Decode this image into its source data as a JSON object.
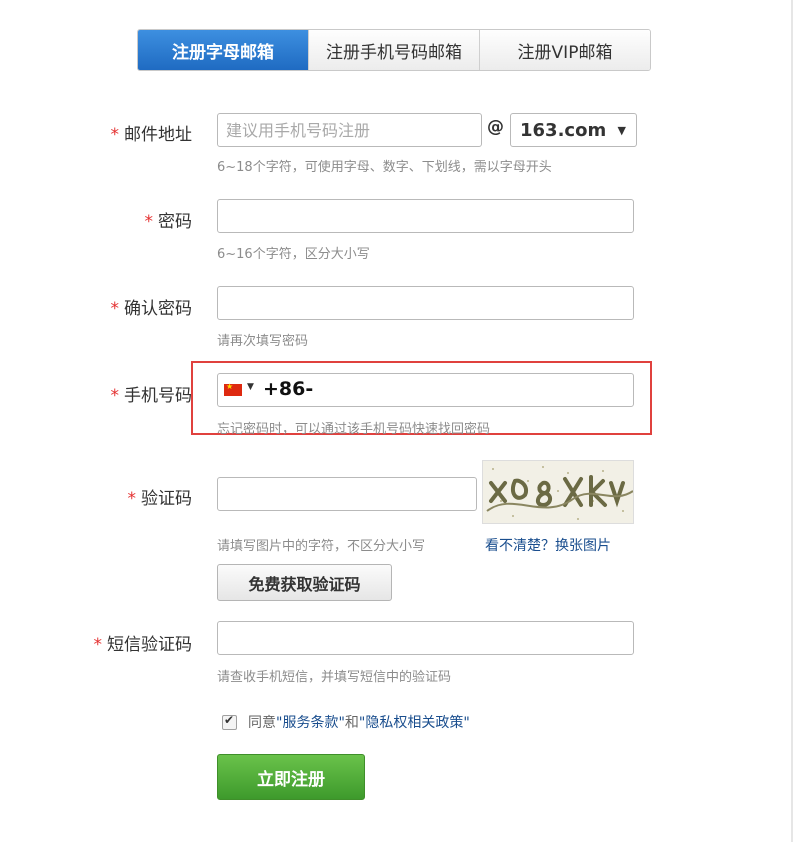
{
  "tabs": [
    {
      "label": "注册字母邮箱",
      "active": true
    },
    {
      "label": "注册手机号码邮箱",
      "active": false
    },
    {
      "label": "注册VIP邮箱",
      "active": false
    }
  ],
  "required_mark": "*",
  "email": {
    "label": "邮件地址",
    "placeholder": "建议用手机号码注册",
    "value": "",
    "at": "@",
    "domain_selected": "163.com",
    "hint": "6~18个字符，可使用字母、数字、下划线，需以字母开头"
  },
  "password": {
    "label": "密码",
    "value": "",
    "hint": "6~16个字符，区分大小写"
  },
  "confirm_password": {
    "label": "确认密码",
    "value": "",
    "hint": "请再次填写密码"
  },
  "phone": {
    "label": "手机号码",
    "country_flag": "china-flag-icon",
    "prefix": "+86-",
    "value": "",
    "hint": "忘记密码时，可以通过该手机号码快速找回密码",
    "highlight_color": "#e0413e"
  },
  "captcha": {
    "label": "验证码",
    "value": "",
    "hint": "请填写图片中的字符，不区分大小写",
    "refresh_link": "看不清楚？换张图片"
  },
  "get_code_button": "免费获取验证码",
  "sms_code": {
    "label": "短信验证码",
    "value": "",
    "hint": "请查收手机短信，并填写短信中的验证码"
  },
  "agreement": {
    "checked": true,
    "prefix": "同意",
    "terms": "\"服务条款\"",
    "and": "和",
    "privacy": "\"隐私权相关政策\""
  },
  "submit_button": "立即注册",
  "colors": {
    "tab_active": "#1f6bc2",
    "required": "#e43030",
    "link": "#1a4e8e",
    "submit": "#3e9a2c"
  }
}
